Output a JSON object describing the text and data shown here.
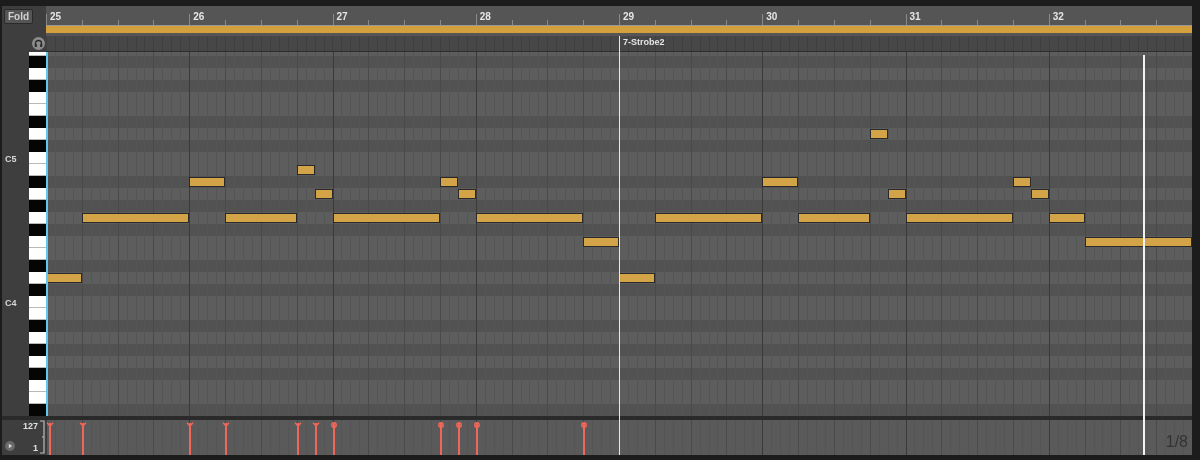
{
  "fold_button": {
    "label": "Fold"
  },
  "ruler": {
    "bars": [
      "25",
      "26",
      "27",
      "28",
      "29",
      "30",
      "31",
      "32"
    ]
  },
  "clip_marker": {
    "label": "7-Strobe2"
  },
  "keyboard": {
    "octave_labels": [
      "C5",
      "C4"
    ]
  },
  "velocity_lane": {
    "max_label": "127",
    "min_label": "1",
    "stems": [
      {
        "kind": "fork",
        "level": 1
      },
      {
        "kind": "fork",
        "level": 1
      },
      {
        "kind": "fork",
        "level": 1
      },
      {
        "kind": "fork",
        "level": 1
      },
      {
        "kind": "fork",
        "level": 1
      },
      {
        "kind": "fork",
        "level": 1
      },
      {
        "kind": "circle",
        "level": 1
      },
      {
        "kind": "circle",
        "level": 1
      },
      {
        "kind": "circle",
        "level": 1
      },
      {
        "kind": "circle",
        "level": 1
      },
      {
        "kind": "circle",
        "level": 1
      }
    ]
  },
  "grid_label": "1/8"
}
